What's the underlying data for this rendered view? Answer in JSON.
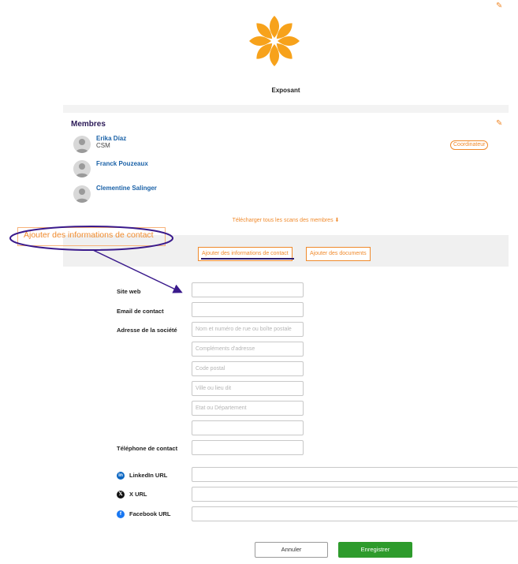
{
  "company": {
    "name": "Exposant"
  },
  "members": {
    "title": "Membres",
    "items": [
      {
        "name": "Erika Díaz",
        "role": "CSM",
        "badge": "Coordinateur"
      },
      {
        "name": "Franck Pouzeaux"
      },
      {
        "name": "Clementine Salinger"
      }
    ],
    "download_label": "Télécharger tous les scans des membres"
  },
  "tabs": {
    "contact_label": "Ajouter des informations de contact",
    "documents_label": "Ajouter des documents"
  },
  "callout": {
    "text": "Ajouter des informations de contact"
  },
  "form": {
    "website_label": "Site web",
    "email_label": "Email de contact",
    "address_label": "Adresse de la société",
    "address_street_placeholder": "Nom et numéro de rue ou boîte postale",
    "address_extra_placeholder": "Compléments d'adresse",
    "postal_code_placeholder": "Code postal",
    "city_placeholder": "Ville ou lieu dit",
    "state_placeholder": "Etat ou Département",
    "phone_label": "Téléphone de contact",
    "linkedin_label": "LinkedIn URL",
    "x_label": "X URL",
    "facebook_label": "Facebook URL"
  },
  "actions": {
    "cancel_label": "Annuler",
    "save_label": "Enregistrer"
  },
  "colors": {
    "accent": "#f08a2c",
    "primary_dark": "#2b1a57",
    "link": "#1b62a8",
    "success": "#2e9b2c",
    "logo": "#f7a21b"
  },
  "icons": [
    "edit-icon",
    "user-avatar-icon",
    "download-icon",
    "linkedin-icon",
    "x-icon",
    "facebook-icon"
  ]
}
